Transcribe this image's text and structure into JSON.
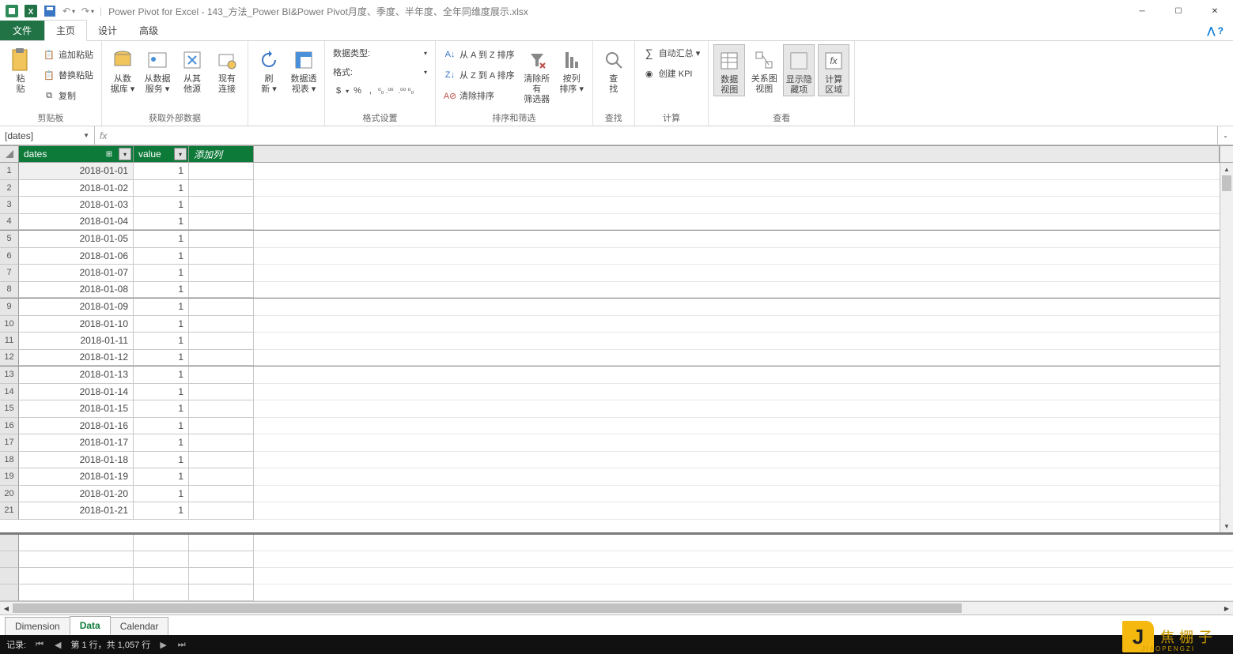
{
  "title": "Power Pivot for Excel - 143_方法_Power BI&Power Pivot月度、季度、半年度、全年同维度展示.xlsx",
  "tabs": {
    "file": "文件",
    "home": "主页",
    "design": "设计",
    "advanced": "高级"
  },
  "ribbon": {
    "clipboard": {
      "paste": "粘\n贴",
      "pasteAppend": "追加粘贴",
      "pasteReplace": "替换粘贴",
      "copy": "复制",
      "label": "剪贴板"
    },
    "getData": {
      "fromDb": "从数\n据库 ▾",
      "fromSvc": "从数据\n服务 ▾",
      "fromOther": "从其\n他源",
      "existing": "现有\n连接",
      "label": "获取外部数据"
    },
    "refresh": {
      "refresh": "刷\n新 ▾",
      "pivot": "数据透\n视表 ▾"
    },
    "format": {
      "dataType": "数据类型:",
      "fmt": "格式:",
      "label": "格式设置"
    },
    "sort": {
      "az": "从 A 到 Z 排序",
      "za": "从 Z 到 A 排序",
      "clear": "清除排序",
      "clearFilter": "清除所有\n筛选器",
      "byCol": "按列\n排序 ▾",
      "label": "排序和筛选"
    },
    "find": {
      "find": "查\n找",
      "label": "查找"
    },
    "calc": {
      "autosum": "自动汇总 ▾",
      "kpi": "创建 KPI",
      "label": "计算"
    },
    "view": {
      "dataView": "数据\n视图",
      "diagram": "关系图\n视图",
      "hidden": "显示隐\n藏项",
      "calcArea": "计算\n区域",
      "label": "查看"
    }
  },
  "nameBox": "[dates]",
  "columns": {
    "c1": "dates",
    "c2": "value",
    "c3": "添加列"
  },
  "rows": [
    {
      "n": 1,
      "d": "2018-01-01",
      "v": "1"
    },
    {
      "n": 2,
      "d": "2018-01-02",
      "v": "1"
    },
    {
      "n": 3,
      "d": "2018-01-03",
      "v": "1"
    },
    {
      "n": 4,
      "d": "2018-01-04",
      "v": "1"
    },
    {
      "n": 5,
      "d": "2018-01-05",
      "v": "1"
    },
    {
      "n": 6,
      "d": "2018-01-06",
      "v": "1"
    },
    {
      "n": 7,
      "d": "2018-01-07",
      "v": "1"
    },
    {
      "n": 8,
      "d": "2018-01-08",
      "v": "1"
    },
    {
      "n": 9,
      "d": "2018-01-09",
      "v": "1"
    },
    {
      "n": 10,
      "d": "2018-01-10",
      "v": "1"
    },
    {
      "n": 11,
      "d": "2018-01-11",
      "v": "1"
    },
    {
      "n": 12,
      "d": "2018-01-12",
      "v": "1"
    },
    {
      "n": 13,
      "d": "2018-01-13",
      "v": "1"
    },
    {
      "n": 14,
      "d": "2018-01-14",
      "v": "1"
    },
    {
      "n": 15,
      "d": "2018-01-15",
      "v": "1"
    },
    {
      "n": 16,
      "d": "2018-01-16",
      "v": "1"
    },
    {
      "n": 17,
      "d": "2018-01-17",
      "v": "1"
    },
    {
      "n": 18,
      "d": "2018-01-18",
      "v": "1"
    },
    {
      "n": 19,
      "d": "2018-01-19",
      "v": "1"
    },
    {
      "n": 20,
      "d": "2018-01-20",
      "v": "1"
    },
    {
      "n": 21,
      "d": "2018-01-21",
      "v": "1"
    }
  ],
  "sheets": {
    "s1": "Dimension",
    "s2": "Data",
    "s3": "Calendar"
  },
  "status": {
    "label": "记录:",
    "pos": "第 1 行，共 1,057 行"
  },
  "watermark": {
    "main": "焦棚子",
    "sub": "JIAOPENGZI"
  },
  "formatSymbols": {
    "s1": "$",
    "s2": "%",
    "s3": ",",
    "s4": "⁰₀ .⁰⁰",
    "s5": ".⁰⁰ ⁰₀"
  }
}
